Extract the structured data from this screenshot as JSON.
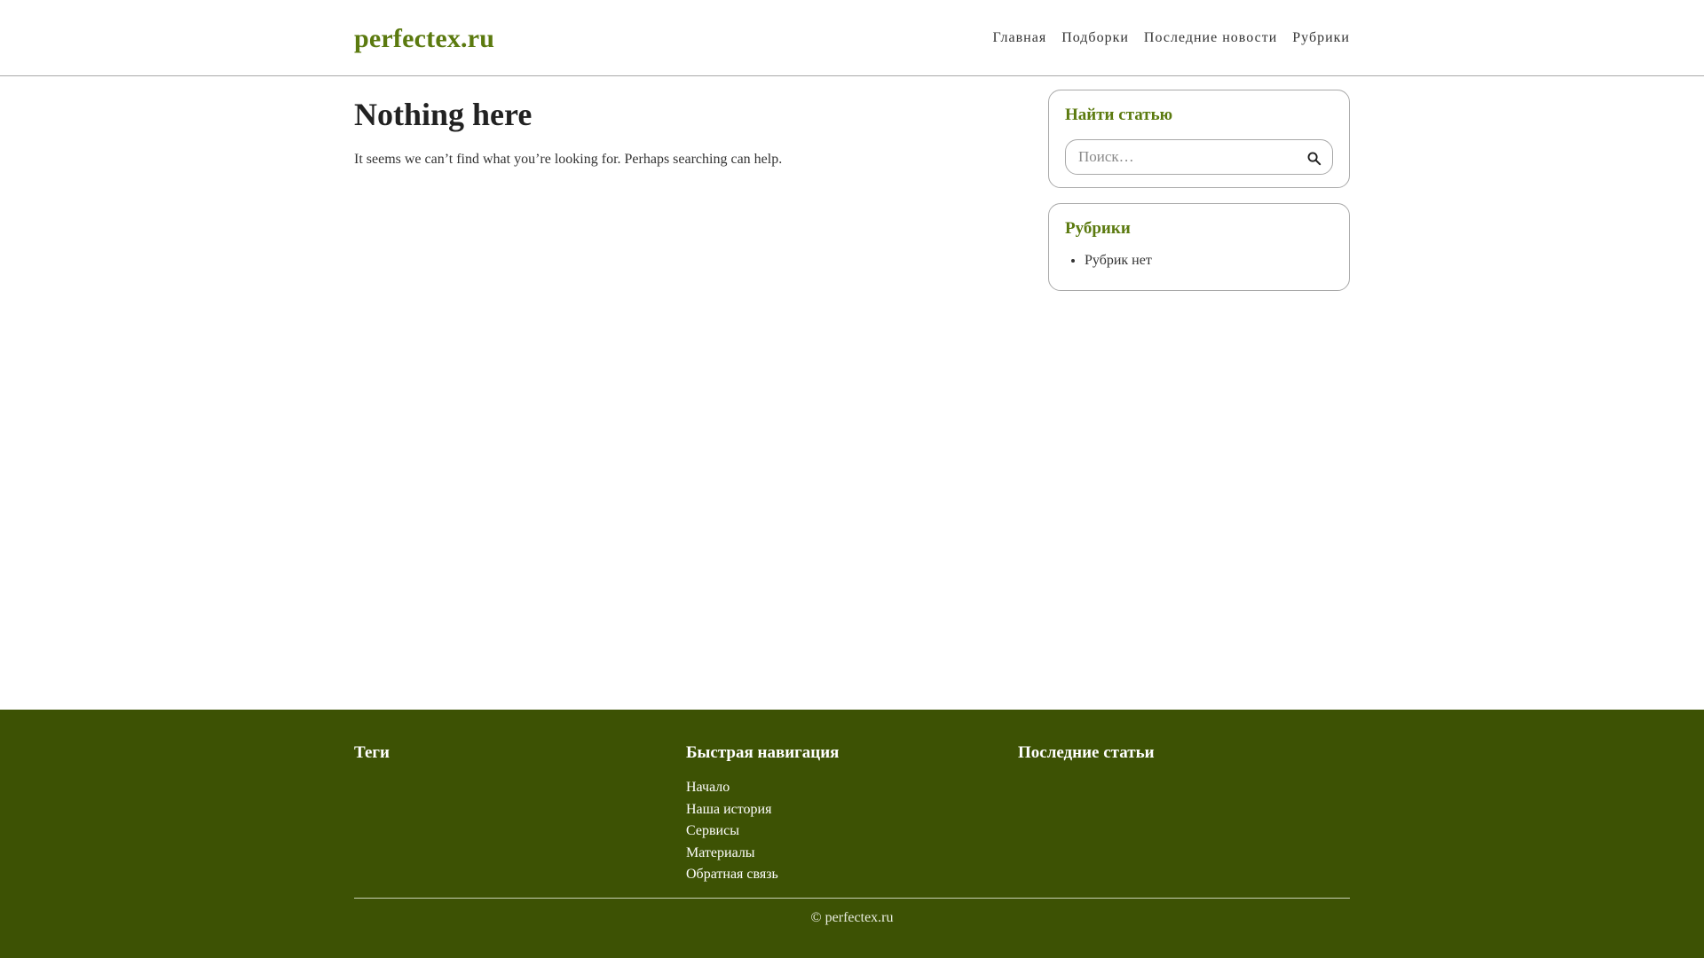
{
  "header": {
    "logo": "perfectex.ru",
    "nav": [
      {
        "label": "Главная"
      },
      {
        "label": "Подборки"
      },
      {
        "label": "Последние новости"
      },
      {
        "label": "Рубрики"
      }
    ]
  },
  "main": {
    "title": "Nothing here",
    "message": "It seems we can’t find what you’re looking for. Perhaps searching can help."
  },
  "sidebar": {
    "search_widget": {
      "title": "Найти статью",
      "placeholder": "Поиск…",
      "icon": "search-icon"
    },
    "categories_widget": {
      "title": "Рубрики",
      "items": [
        "Рубрик нет"
      ]
    }
  },
  "footer": {
    "tags_title": "Теги",
    "nav_title": "Быстрая навигация",
    "nav_links": [
      "Начало",
      "Наша история",
      "Сервисы",
      "Материалы",
      "Обратная связь"
    ],
    "recent_title": "Последние статьи",
    "copyright": "© perfectex.ru"
  },
  "colors": {
    "brand": "#5b7a0f",
    "footer_bg": "#3d5204"
  }
}
